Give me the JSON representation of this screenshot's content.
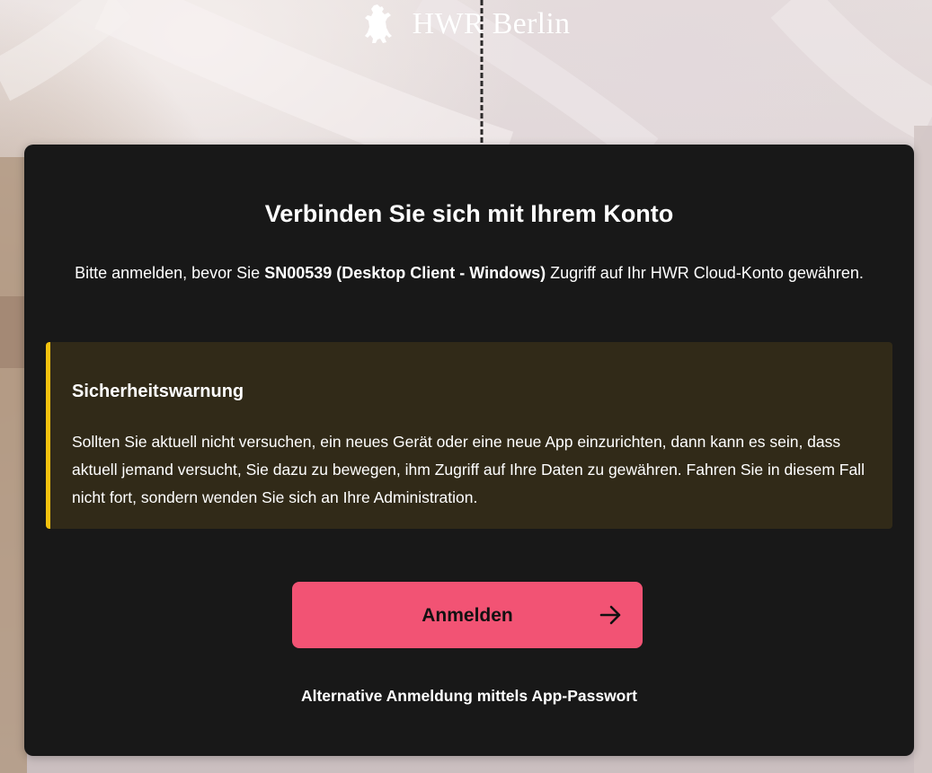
{
  "brand": {
    "name": "HWR Berlin",
    "logo_icon": "berlin-bear-icon",
    "logo_color": "#ffffff"
  },
  "card": {
    "title": "Verbinden Sie sich mit Ihrem Konto",
    "subtitle_prefix": "Bitte anmelden, bevor Sie ",
    "subtitle_client": "SN00539 (Desktop Client - Windows)",
    "subtitle_suffix": " Zugriff auf Ihr HWR Cloud-Konto gewähren.",
    "background_color": "#181818"
  },
  "warning": {
    "title": "Sicherheitswarnung",
    "text": "Sollten Sie aktuell nicht versuchen, ein neues Gerät oder eine neue App einzurichten, dann kann es sein, dass aktuell jemand versucht, Sie dazu zu bewegen, ihm Zugriff auf Ihre Daten zu gewähren. Fahren Sie in diesem Fall nicht fort, sondern wenden Sie sich an Ihre Administration.",
    "accent_color": "#f4c20f",
    "background_color": "#312a18"
  },
  "login_button": {
    "label": "Anmelden",
    "icon": "arrow-right-icon",
    "color": "#f25374"
  },
  "alternative_login": {
    "label": "Alternative Anmeldung mittels App-Passwort"
  }
}
